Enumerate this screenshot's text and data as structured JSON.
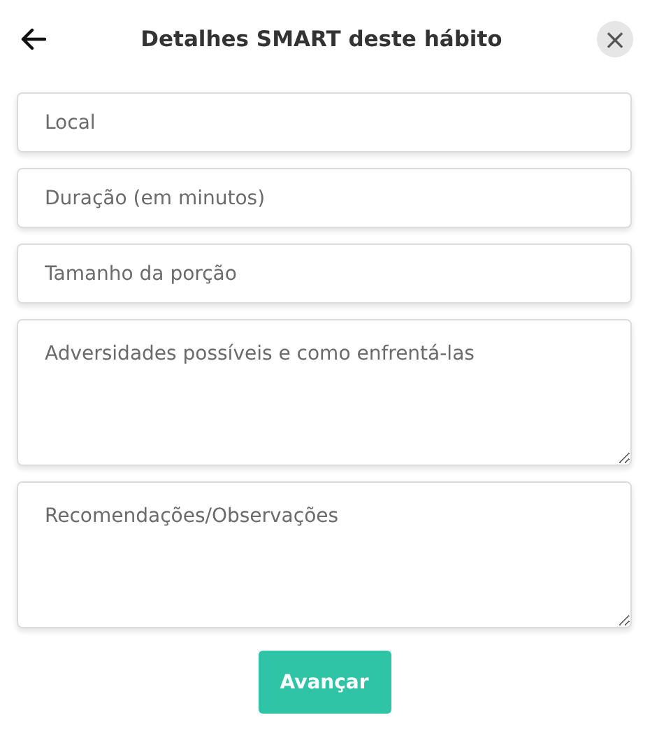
{
  "header": {
    "title": "Detalhes SMART deste hábito",
    "close": "×"
  },
  "fields": [
    {
      "kind": "input",
      "placeholder": "Local"
    },
    {
      "kind": "input",
      "placeholder": "Duração (em minutos)"
    },
    {
      "kind": "input",
      "placeholder": "Tamanho da porção"
    },
    {
      "kind": "textarea",
      "placeholder": "Adversidades possíveis e como enfrentá-las"
    },
    {
      "kind": "textarea",
      "placeholder": "Recomendações/Observações"
    }
  ],
  "button": "Avançar"
}
